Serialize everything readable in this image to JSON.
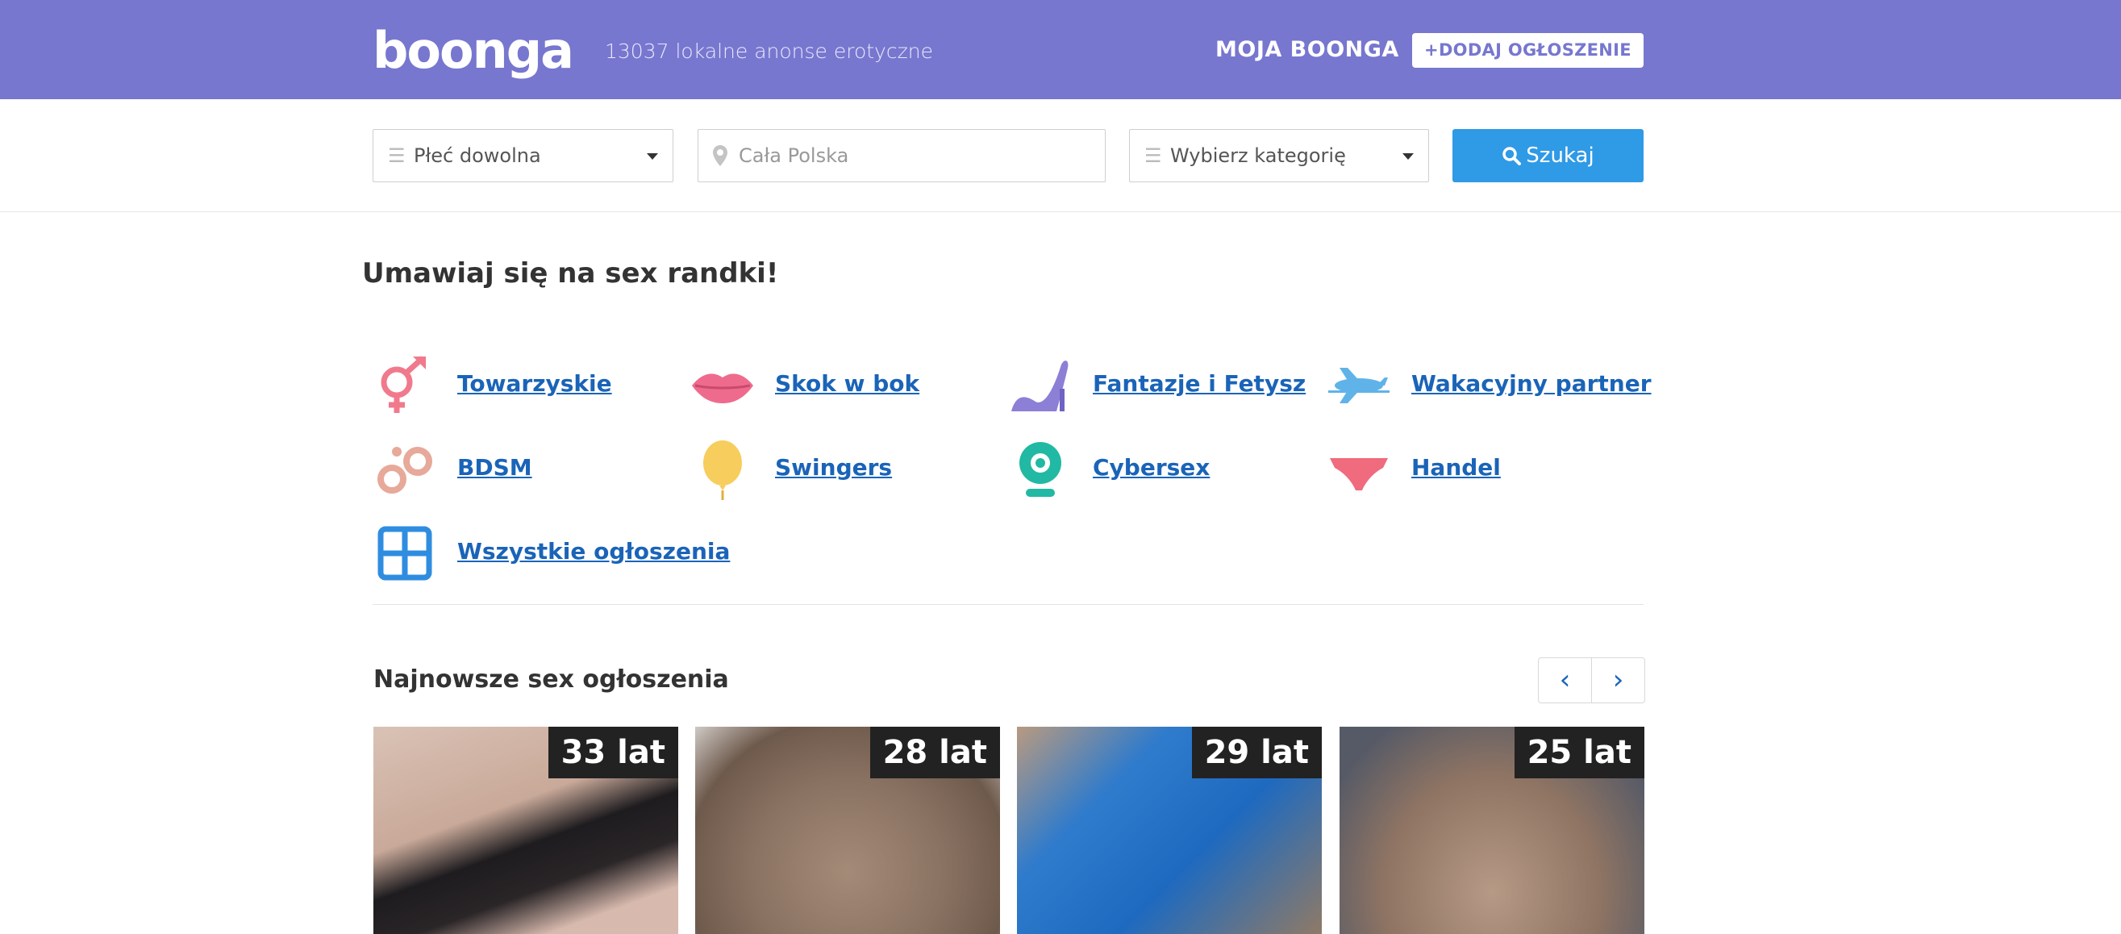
{
  "header": {
    "logo": "boonga",
    "tagline": "13037 lokalne anonse erotyczne",
    "nav_account": "MOJA BOONGA",
    "add_button": "+DODAJ OGŁOSZENIE"
  },
  "search": {
    "gender_select": "Płeć dowolna",
    "location_placeholder": "Cała Polska",
    "category_select": "Wybierz kategorię",
    "submit_label": "Szukaj"
  },
  "main": {
    "title": "Umawiaj się na sex randki!",
    "categories": [
      {
        "label": "Towarzyskie",
        "icon": "gender-symbols-icon"
      },
      {
        "label": "Skok w bok",
        "icon": "lips-icon"
      },
      {
        "label": "Fantazje i Fetysz",
        "icon": "high-heel-icon"
      },
      {
        "label": "Wakacyjny partner",
        "icon": "airplane-icon"
      },
      {
        "label": "BDSM",
        "icon": "handcuffs-icon"
      },
      {
        "label": "Swingers",
        "icon": "balloon-icon"
      },
      {
        "label": "Cybersex",
        "icon": "webcam-icon"
      },
      {
        "label": "Handel",
        "icon": "underwear-icon"
      },
      {
        "label": "Wszystkie ogłoszenia",
        "icon": "grid-icon"
      }
    ]
  },
  "newest": {
    "title": "Najnowsze sex ogłoszenia",
    "prev_icon": "‹",
    "next_icon": "›",
    "cards": [
      {
        "age": "33 lat"
      },
      {
        "age": "28 lat"
      },
      {
        "age": "29 lat"
      },
      {
        "age": "25 lat"
      }
    ]
  },
  "colors": {
    "header_bg": "#7777d0",
    "search_button": "#2f9ae6",
    "link": "#1a64b8"
  }
}
